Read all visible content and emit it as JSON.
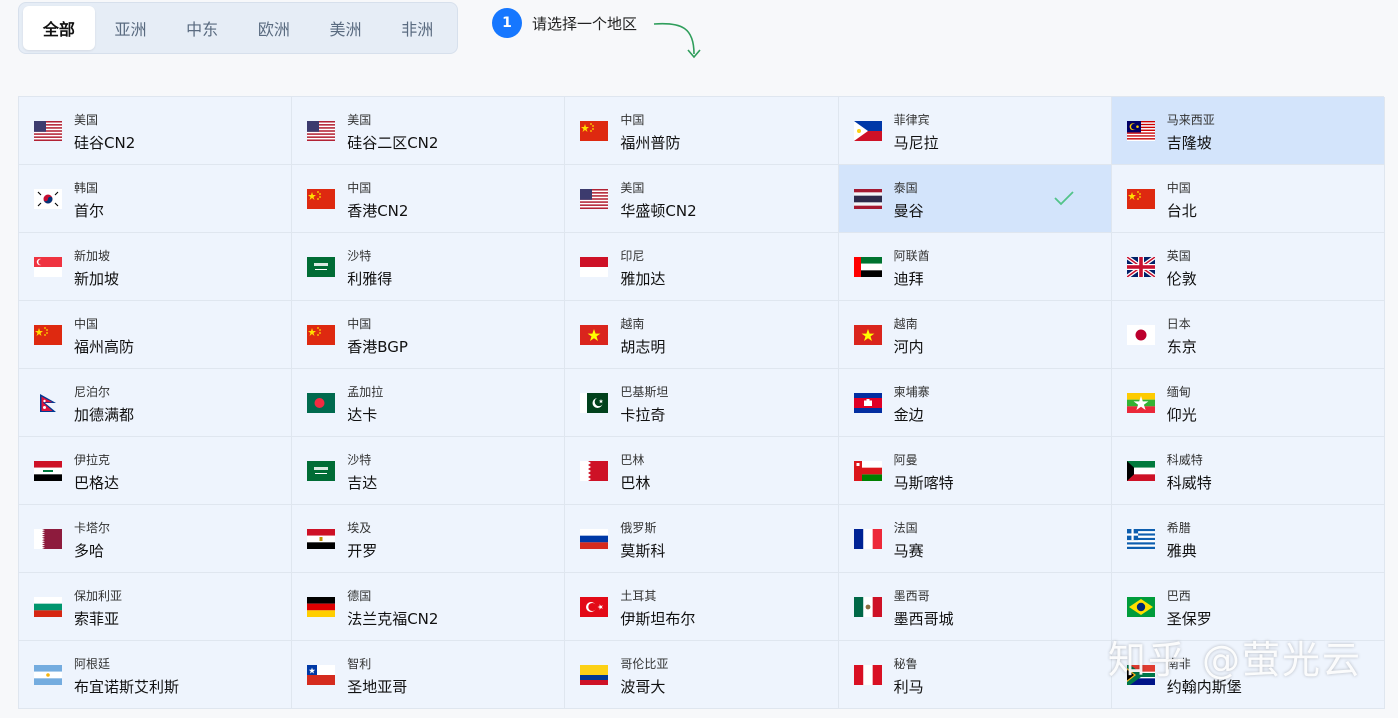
{
  "tabs": [
    {
      "label": "全部",
      "active": true
    },
    {
      "label": "亚洲",
      "active": false
    },
    {
      "label": "中东",
      "active": false
    },
    {
      "label": "欧洲",
      "active": false
    },
    {
      "label": "美洲",
      "active": false
    },
    {
      "label": "非洲",
      "active": false
    }
  ],
  "step": {
    "number": "1",
    "text": "请选择一个地区"
  },
  "regions": [
    {
      "country": "美国",
      "city": "硅谷CN2",
      "flag": "us"
    },
    {
      "country": "美国",
      "city": "硅谷二区CN2",
      "flag": "us"
    },
    {
      "country": "中国",
      "city": "福州普防",
      "flag": "cn"
    },
    {
      "country": "菲律宾",
      "city": "马尼拉",
      "flag": "ph"
    },
    {
      "country": "马来西亚",
      "city": "吉隆坡",
      "flag": "my",
      "highlight": true
    },
    {
      "country": "韩国",
      "city": "首尔",
      "flag": "kr"
    },
    {
      "country": "中国",
      "city": "香港CN2",
      "flag": "cn"
    },
    {
      "country": "美国",
      "city": "华盛顿CN2",
      "flag": "us"
    },
    {
      "country": "泰国",
      "city": "曼谷",
      "flag": "th",
      "highlight": true,
      "checked": true
    },
    {
      "country": "中国",
      "city": "台北",
      "flag": "cn"
    },
    {
      "country": "新加坡",
      "city": "新加坡",
      "flag": "sg"
    },
    {
      "country": "沙特",
      "city": "利雅得",
      "flag": "sa"
    },
    {
      "country": "印尼",
      "city": "雅加达",
      "flag": "id"
    },
    {
      "country": "阿联酋",
      "city": "迪拜",
      "flag": "ae"
    },
    {
      "country": "英国",
      "city": "伦敦",
      "flag": "gb"
    },
    {
      "country": "中国",
      "city": "福州高防",
      "flag": "cn"
    },
    {
      "country": "中国",
      "city": "香港BGP",
      "flag": "cn"
    },
    {
      "country": "越南",
      "city": "胡志明",
      "flag": "vn"
    },
    {
      "country": "越南",
      "city": "河内",
      "flag": "vn"
    },
    {
      "country": "日本",
      "city": "东京",
      "flag": "jp"
    },
    {
      "country": "尼泊尔",
      "city": "加德满都",
      "flag": "np"
    },
    {
      "country": "孟加拉",
      "city": "达卡",
      "flag": "bd"
    },
    {
      "country": "巴基斯坦",
      "city": "卡拉奇",
      "flag": "pk"
    },
    {
      "country": "柬埔寨",
      "city": "金边",
      "flag": "kh"
    },
    {
      "country": "缅甸",
      "city": "仰光",
      "flag": "mm"
    },
    {
      "country": "伊拉克",
      "city": "巴格达",
      "flag": "iq"
    },
    {
      "country": "沙特",
      "city": "吉达",
      "flag": "sa"
    },
    {
      "country": "巴林",
      "city": "巴林",
      "flag": "bh"
    },
    {
      "country": "阿曼",
      "city": "马斯喀特",
      "flag": "om"
    },
    {
      "country": "科威特",
      "city": "科威特",
      "flag": "kw"
    },
    {
      "country": "卡塔尔",
      "city": "多哈",
      "flag": "qa"
    },
    {
      "country": "埃及",
      "city": "开罗",
      "flag": "eg"
    },
    {
      "country": "俄罗斯",
      "city": "莫斯科",
      "flag": "ru"
    },
    {
      "country": "法国",
      "city": "马赛",
      "flag": "fr"
    },
    {
      "country": "希腊",
      "city": "雅典",
      "flag": "gr"
    },
    {
      "country": "保加利亚",
      "city": "索菲亚",
      "flag": "bg"
    },
    {
      "country": "德国",
      "city": "法兰克福CN2",
      "flag": "de"
    },
    {
      "country": "土耳其",
      "city": "伊斯坦布尔",
      "flag": "tr"
    },
    {
      "country": "墨西哥",
      "city": "墨西哥城",
      "flag": "mx"
    },
    {
      "country": "巴西",
      "city": "圣保罗",
      "flag": "br"
    },
    {
      "country": "阿根廷",
      "city": "布宜诺斯艾利斯",
      "flag": "ar"
    },
    {
      "country": "智利",
      "city": "圣地亚哥",
      "flag": "cl"
    },
    {
      "country": "哥伦比亚",
      "city": "波哥大",
      "flag": "co"
    },
    {
      "country": "秘鲁",
      "city": "利马",
      "flag": "pe"
    },
    {
      "country": "南非",
      "city": "约翰内斯堡",
      "flag": "za"
    }
  ],
  "watermark": "知乎 @萤光云"
}
